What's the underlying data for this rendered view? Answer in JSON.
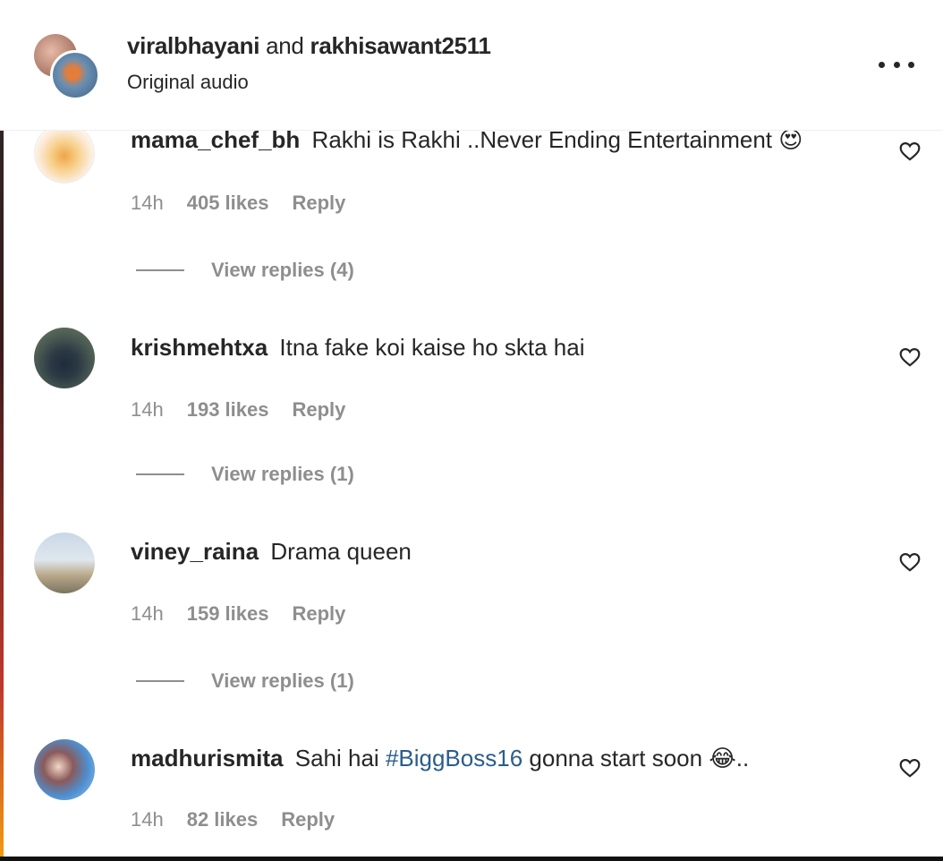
{
  "header": {
    "user1": "viralbhayani",
    "and": "and",
    "user2": "rakhisawant2511",
    "subtitle": "Original audio",
    "more_icon": "more-horizontal-icon"
  },
  "comments": [
    {
      "username": "mama_chef_bh",
      "text": "Rakhi is Rakhi ..Never Ending Entertainment",
      "emoji": "😍",
      "time": "14h",
      "likes": "405 likes",
      "reply": "Reply",
      "view_replies": "View replies (4)"
    },
    {
      "username": "krishmehtxa",
      "text": "Itna fake koi kaise ho skta hai",
      "time": "14h",
      "likes": "193 likes",
      "reply": "Reply",
      "view_replies": "View replies (1)"
    },
    {
      "username": "viney_raina",
      "text": "Drama queen",
      "time": "14h",
      "likes": "159 likes",
      "reply": "Reply",
      "view_replies": "View replies (1)"
    },
    {
      "username": "madhurismita",
      "text_before": "Sahi hai",
      "hashtag": "#BiggBoss16",
      "text_after": "gonna start soon",
      "emoji": "😂..",
      "time": "14h",
      "likes": "82 likes",
      "reply": "Reply"
    }
  ],
  "colors": {
    "text": "#262626",
    "muted": "#8e8e8e",
    "hashtag": "#2a5d8a"
  }
}
